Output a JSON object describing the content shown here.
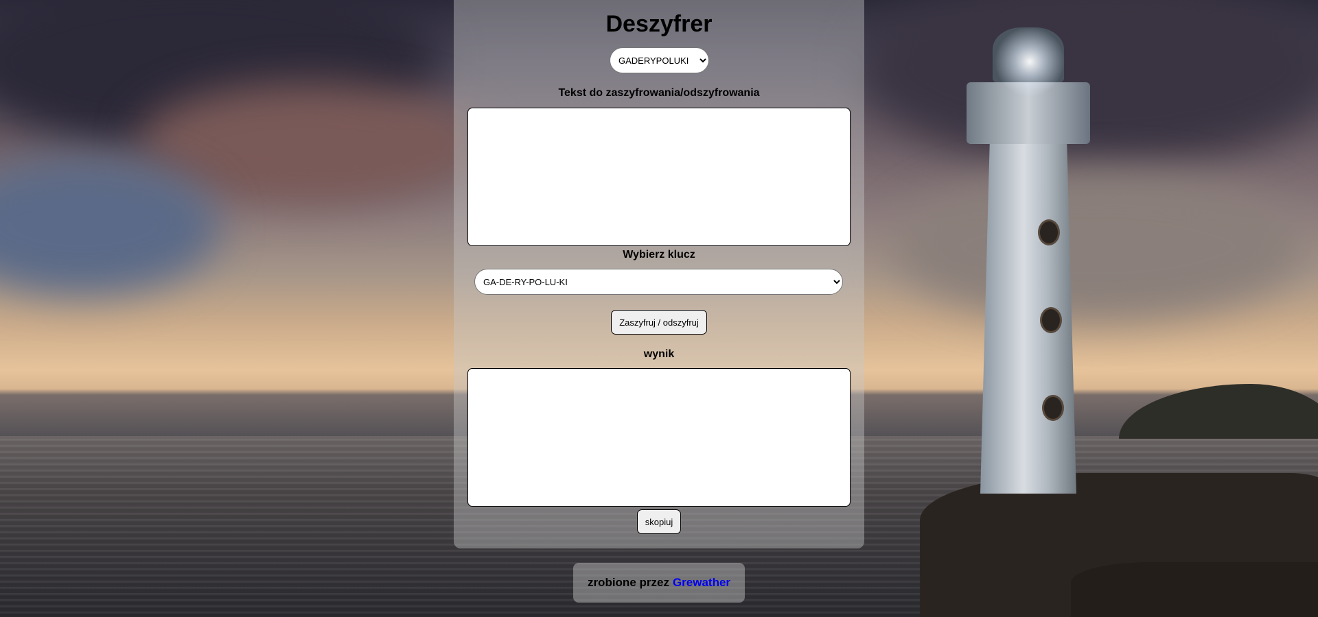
{
  "page": {
    "title": "Deszyfrer"
  },
  "cipher_select": {
    "selected": "GADERYPOLUKI"
  },
  "input_section": {
    "label": "Tekst do zaszyfrowania/odszyfrowania",
    "value": ""
  },
  "key_section": {
    "label": "Wybierz klucz",
    "selected": "GA-DE-RY-PO-LU-KI"
  },
  "actions": {
    "run_label": "Zaszyfruj / odszyfruj",
    "copy_label": "skopiuj"
  },
  "output_section": {
    "label": "wynik",
    "value": ""
  },
  "footer": {
    "prefix": "zrobione przez",
    "author_link": "Grewather"
  },
  "colors": {
    "panel_overlay": "#c8c8c8",
    "link": "#0000ee",
    "text": "#000000"
  }
}
